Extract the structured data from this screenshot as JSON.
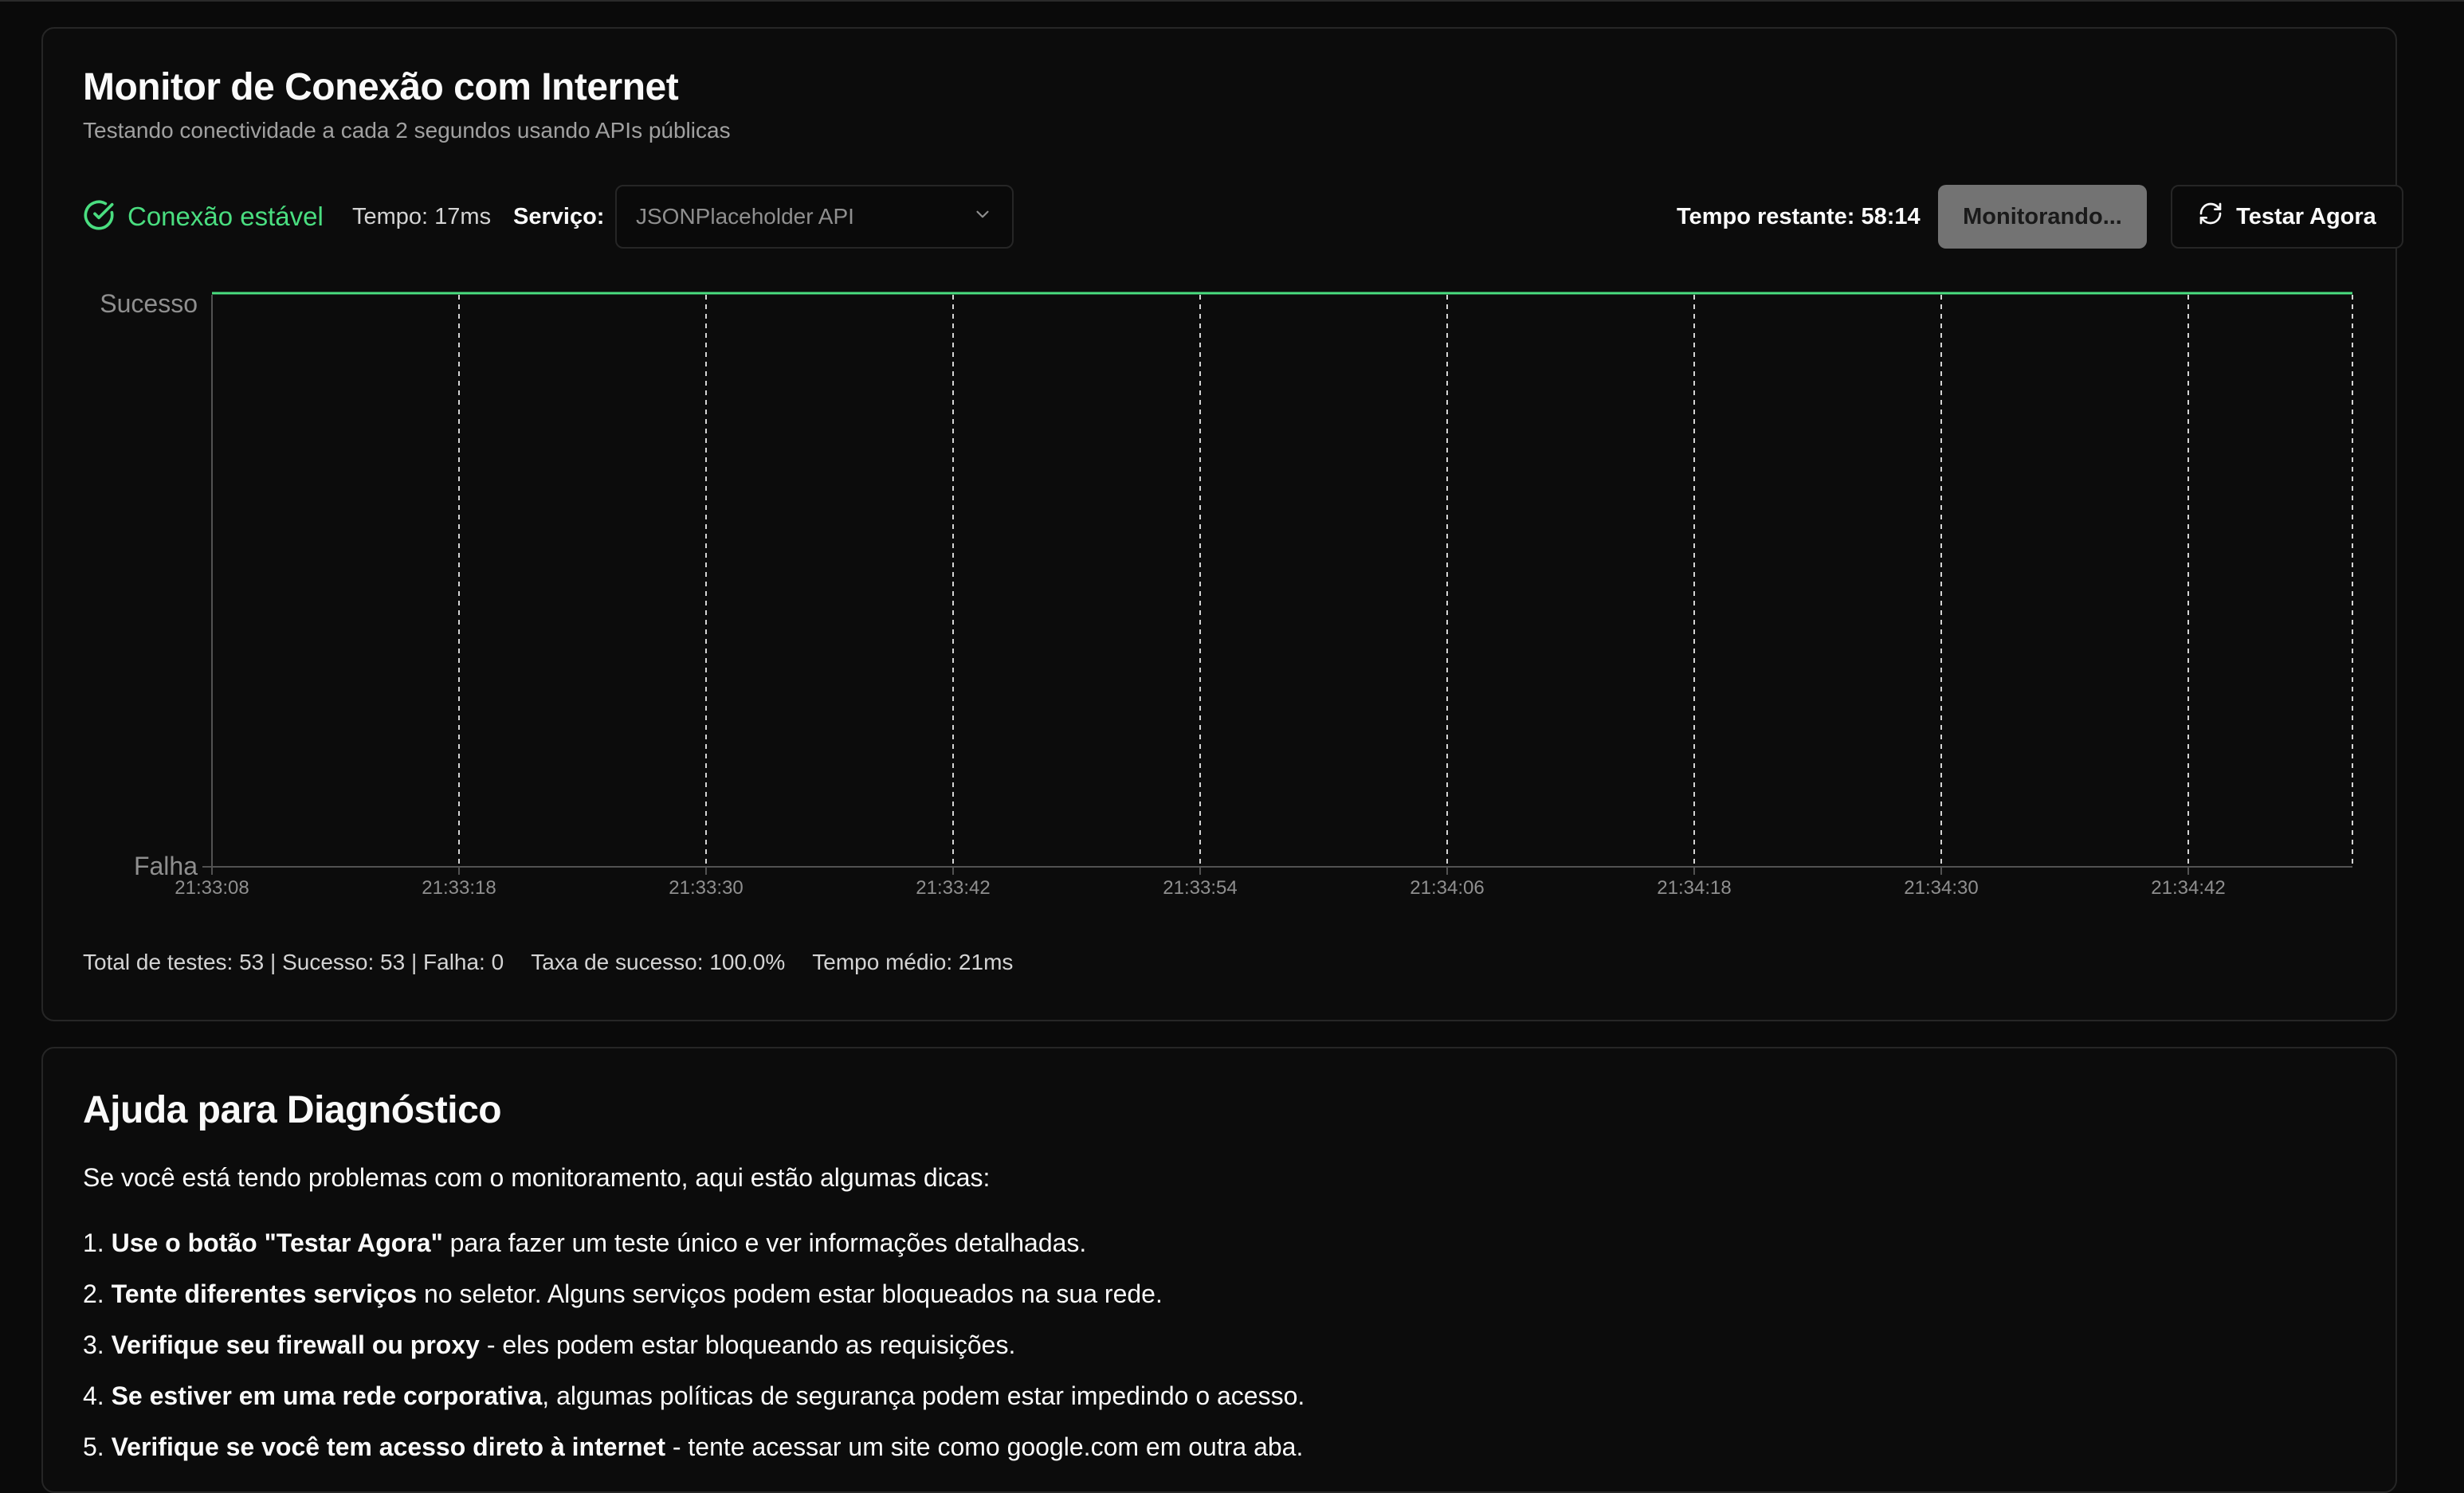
{
  "monitor": {
    "title": "Monitor de Conexão com Internet",
    "subtitle": "Testando conectividade a cada 2 segundos usando APIs públicas",
    "status_text": "Conexão estável",
    "ping_text": "Tempo: 17ms",
    "service_label": "Serviço:",
    "service_selected": "JSONPlaceholder API",
    "remaining_text": "Tempo restante: 58:14",
    "monitoring_button": "Monitorando...",
    "test_button": "Testar Agora",
    "colors": {
      "success": "#4ade80",
      "muted": "#737373"
    },
    "icons": {
      "status": "check-circle-icon",
      "select": "chevron-down-icon",
      "test": "refresh-icon"
    }
  },
  "chart_data": {
    "type": "line",
    "y_categories": [
      "Falha",
      "Sucesso"
    ],
    "x_ticks": [
      "21:33:08",
      "21:33:18",
      "21:33:30",
      "21:33:42",
      "21:33:54",
      "21:34:06",
      "21:34:18",
      "21:34:30",
      "21:34:42"
    ],
    "series": [
      {
        "color": "#4ade80",
        "values_description_level": "Sucesso",
        "values": [
          1,
          1,
          1,
          1,
          1,
          1,
          1,
          1,
          1,
          1
        ]
      }
    ],
    "grid": "vertical-dashed"
  },
  "stats": {
    "totals": "Total de testes: 53 | Sucesso: 53 | Falha: 0",
    "rate": "Taxa de sucesso: 100.0%",
    "avg": "Tempo médio: 21ms"
  },
  "help": {
    "title": "Ajuda para Diagnóstico",
    "intro": "Se você está tendo problemas com o monitoramento, aqui estão algumas dicas:",
    "tips": [
      {
        "num": "1.",
        "bold": "Use o botão \"Testar Agora\"",
        "rest": " para fazer um teste único e ver informações detalhadas."
      },
      {
        "num": "2.",
        "bold": "Tente diferentes serviços",
        "rest": " no seletor. Alguns serviços podem estar bloqueados na sua rede."
      },
      {
        "num": "3.",
        "bold": "Verifique seu firewall ou proxy",
        "rest": " - eles podem estar bloqueando as requisições."
      },
      {
        "num": "4.",
        "bold": "Se estiver em uma rede corporativa",
        "rest": ", algumas políticas de segurança podem estar impedindo o acesso."
      },
      {
        "num": "5.",
        "bold": "Verifique se você tem acesso direto à internet",
        "rest": " - tente acessar um site como google.com em outra aba."
      }
    ]
  }
}
